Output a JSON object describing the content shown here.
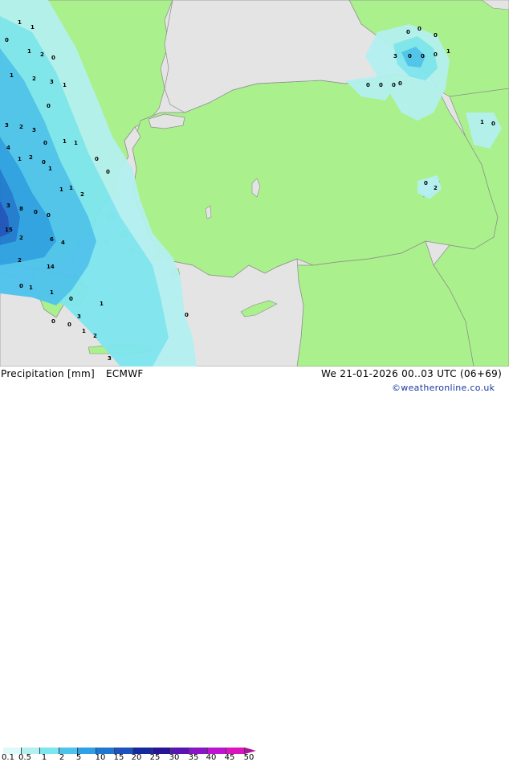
{
  "title": "Precipitation [mm]",
  "model": "ECMWF",
  "valid_time": "We 21-01-2026 00..03 UTC (06+69)",
  "credit": "©weatheronline.co.uk",
  "legend": {
    "ticks": [
      "0.1",
      "0.5",
      "1",
      "2",
      "5",
      "10",
      "15",
      "20",
      "25",
      "30",
      "35",
      "40",
      "45",
      "50"
    ],
    "colors": [
      "#dcfafa",
      "#b4f0f0",
      "#7ee6ee",
      "#4ec3ee",
      "#2ea0e6",
      "#1e78d2",
      "#1e50be",
      "#1428a0",
      "#281496",
      "#5a14b4",
      "#8c14c8",
      "#be14d2",
      "#dc14be",
      "#b0119f"
    ]
  },
  "colors": {
    "land": "#aaf08c",
    "sea": "#e4e4e4",
    "coast": "#8c8c8c"
  },
  "point_labels": [
    "1",
    "1",
    "0",
    "2",
    "0",
    "1",
    "3",
    "1",
    "1",
    "2",
    "0",
    "3",
    "2",
    "3",
    "0",
    "1",
    "1",
    "4",
    "1",
    "2",
    "0",
    "1",
    "1",
    "1",
    "2",
    "0",
    "0",
    "3",
    "8",
    "0",
    "0",
    "15",
    "2",
    "6",
    "4",
    "2",
    "14",
    "0",
    "1",
    "1",
    "0",
    "1",
    "3",
    "0",
    "0",
    "3",
    "2",
    "1",
    "0",
    "0",
    "0",
    "0",
    "0",
    "0",
    "0",
    "0",
    "3",
    "0",
    "0",
    "0",
    "1",
    "1",
    "0",
    "0",
    "2"
  ]
}
